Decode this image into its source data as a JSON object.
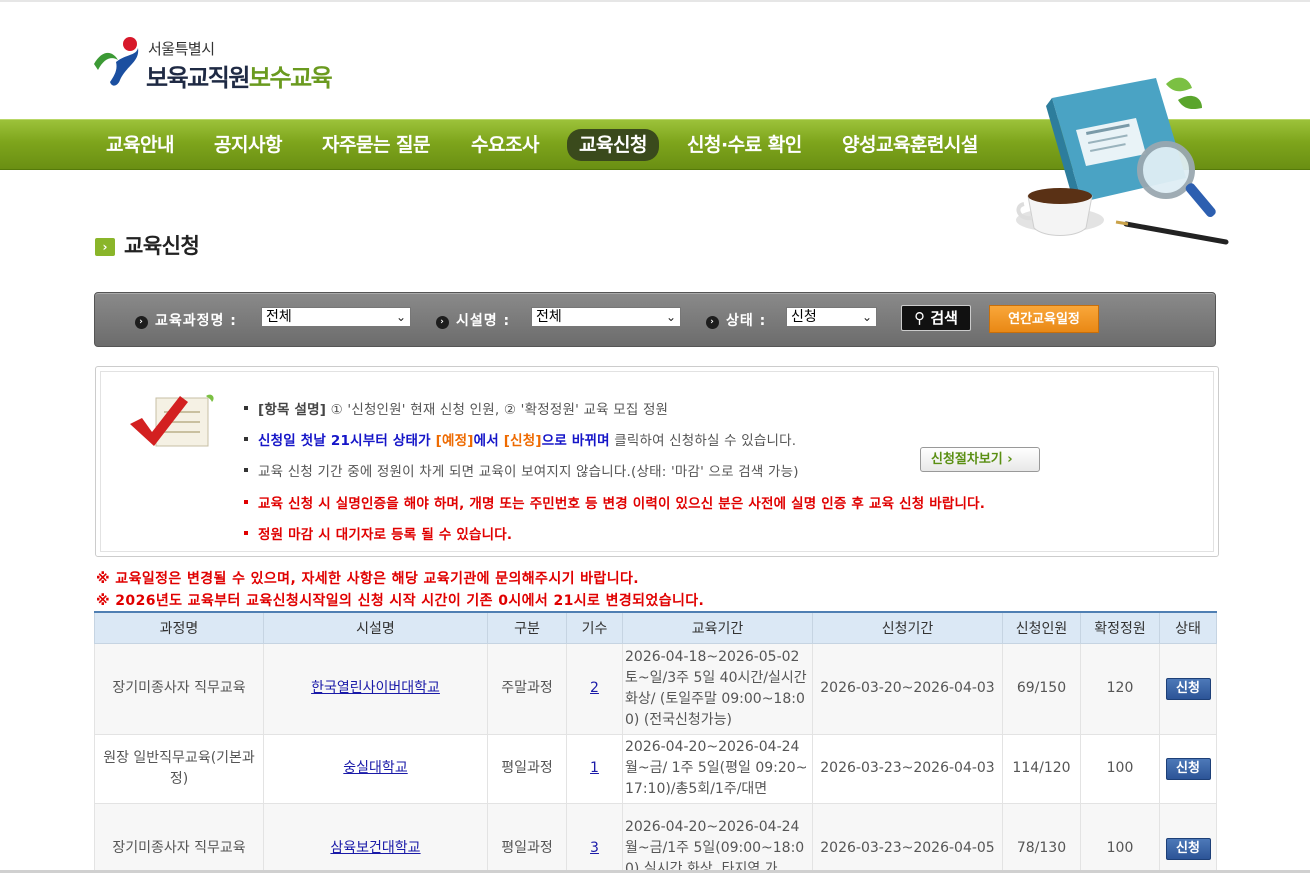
{
  "header": {
    "logo_small": "서울특별시",
    "logo_main_a": "보육교직원",
    "logo_main_b": "보수교육"
  },
  "nav": {
    "items": [
      {
        "label": "교육안내",
        "active": false
      },
      {
        "label": "공지사항",
        "active": false
      },
      {
        "label": "자주묻는 질문",
        "active": false
      },
      {
        "label": "수요조사",
        "active": false
      },
      {
        "label": "교육신청",
        "active": true
      },
      {
        "label": "신청·수료 확인",
        "active": false
      },
      {
        "label": "양성교육훈련시설",
        "active": false
      }
    ]
  },
  "page_title": "교육신청",
  "search": {
    "course_label": "교육과정명 :",
    "course_value": "전체",
    "facility_label": "시설명 :",
    "facility_value": "전체",
    "status_label": "상태 :",
    "status_value": "신청",
    "search_button": "검색",
    "annual_button": "연간교육일정"
  },
  "info": {
    "line1_bold": "[항목 설명]",
    "line1_rest": " ① '신청인원' 현재 신청 인원, ② '확정정원' 교육 모집 정원",
    "line2_a": "신청일 첫날 21시부터 상태가 ",
    "line2_b": "[예정]",
    "line2_c": "에서 ",
    "line2_d": "[신청]",
    "line2_e": "으로 바뀌며",
    "line2_f": " 클릭하여 신청하실 수 있습니다.",
    "line3": "교육 신청 기간 중에 정원이 차게 되면 교육이 보여지지 않습니다.(상태: '마감' 으로 검색 가능)",
    "line4": "교육 신청 시 실명인증을 해야 하며, 개명 또는 주민번호 등 변경 이력이 있으신 분은 사전에 실명 인증 후 교육 신청 바랍니다.",
    "line5": "정원 마감 시 대기자로 등록 될 수 있습니다.",
    "procedure_button": "신청절차보기"
  },
  "notices": [
    "※ 교육일정은 변경될 수 있으며, 자세한 사항은 해당 교육기관에 문의해주시기 바랍니다.",
    "※ 2026년도 교육부터 교육신청시작일의 신청 시작 시간이 기존 0시에서 21시로 변경되었습니다."
  ],
  "table": {
    "headers": [
      "과정명",
      "시설명",
      "구분",
      "기수",
      "교육기간",
      "신청기간",
      "신청인원",
      "확정정원",
      "상태"
    ],
    "rows": [
      {
        "course": "장기미종사자 직무교육",
        "facility": "한국열린사이버대학교",
        "type": "주말과정",
        "term": "2",
        "period": "2026-04-18~2026-05-02 토~일/3주 5일 40시간/실시간화상/ (토일주말 09:00~18:00) (전국신청가능)",
        "apply_period": "2026-03-20~2026-04-03",
        "applicants": "69/150",
        "capacity": "120",
        "status": "신청"
      },
      {
        "course": "원장 일반직무교육(기본과정)",
        "facility": "숭실대학교",
        "type": "평일과정",
        "term": "1",
        "period": "2026-04-20~2026-04-24 월~금/ 1주 5일(평일 09:20~17:10)/총5회/1주/대면",
        "apply_period": "2026-03-23~2026-04-03",
        "applicants": "114/120",
        "capacity": "100",
        "status": "신청"
      },
      {
        "course": "장기미종사자 직무교육",
        "facility": "삼육보건대학교",
        "type": "평일과정",
        "term": "3",
        "period": "2026-04-20~2026-04-24 월~금/1주 5일(09:00~18:00) 실시간 화상, 타지역 가",
        "apply_period": "2026-03-23~2026-04-05",
        "applicants": "78/130",
        "capacity": "100",
        "status": "신청"
      }
    ]
  }
}
